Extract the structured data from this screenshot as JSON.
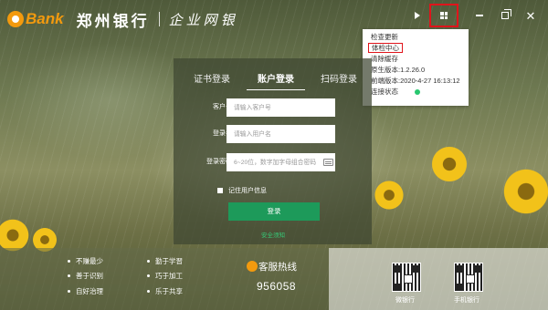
{
  "header": {
    "logo_mark_text": "e",
    "logo_word": "Bank",
    "bank_name": "郑州银行",
    "portal_name": "企业网银"
  },
  "window_controls": {
    "play_icon": "play-icon",
    "menu_icon": "grid-menu-icon",
    "minimize_icon": "minimize-icon",
    "restore_icon": "restore-icon",
    "close_symbol": "✕"
  },
  "menu": {
    "items": [
      "检查更新",
      "体检中心",
      "清除缓存",
      "原生版本:1.2.26.0",
      "前端版本:2020-4-27 16:13:12",
      "连接状态"
    ],
    "status_color": "#28c76f"
  },
  "login": {
    "tabs": {
      "cert": "证书登录",
      "account": "账户登录",
      "scan": "扫码登录"
    },
    "fields": {
      "account_no_label": "客户号",
      "account_no_placeholder": "请输入客户号",
      "username_label": "登录名",
      "username_placeholder": "请输入用户名",
      "password_label": "登录密码",
      "password_placeholder": "6~20位，数字加字母组合密码"
    },
    "remember_label": "记住用户信息",
    "submit_label": "登录",
    "security_link": "安全须知"
  },
  "footer": {
    "slogans": [
      "不赚最少",
      "勤于学習",
      "善于识别",
      "巧于加工",
      "自好治理",
      "乐于共享"
    ],
    "hotline_label": "客服热线",
    "hotline_number": "956058",
    "qr_wechat_label": "微银行",
    "qr_mobile_label": "手机银行"
  },
  "colors": {
    "brand_orange": "#f39a0e",
    "brand_green": "#1d9a5a",
    "highlight_red": "#e0141b"
  }
}
